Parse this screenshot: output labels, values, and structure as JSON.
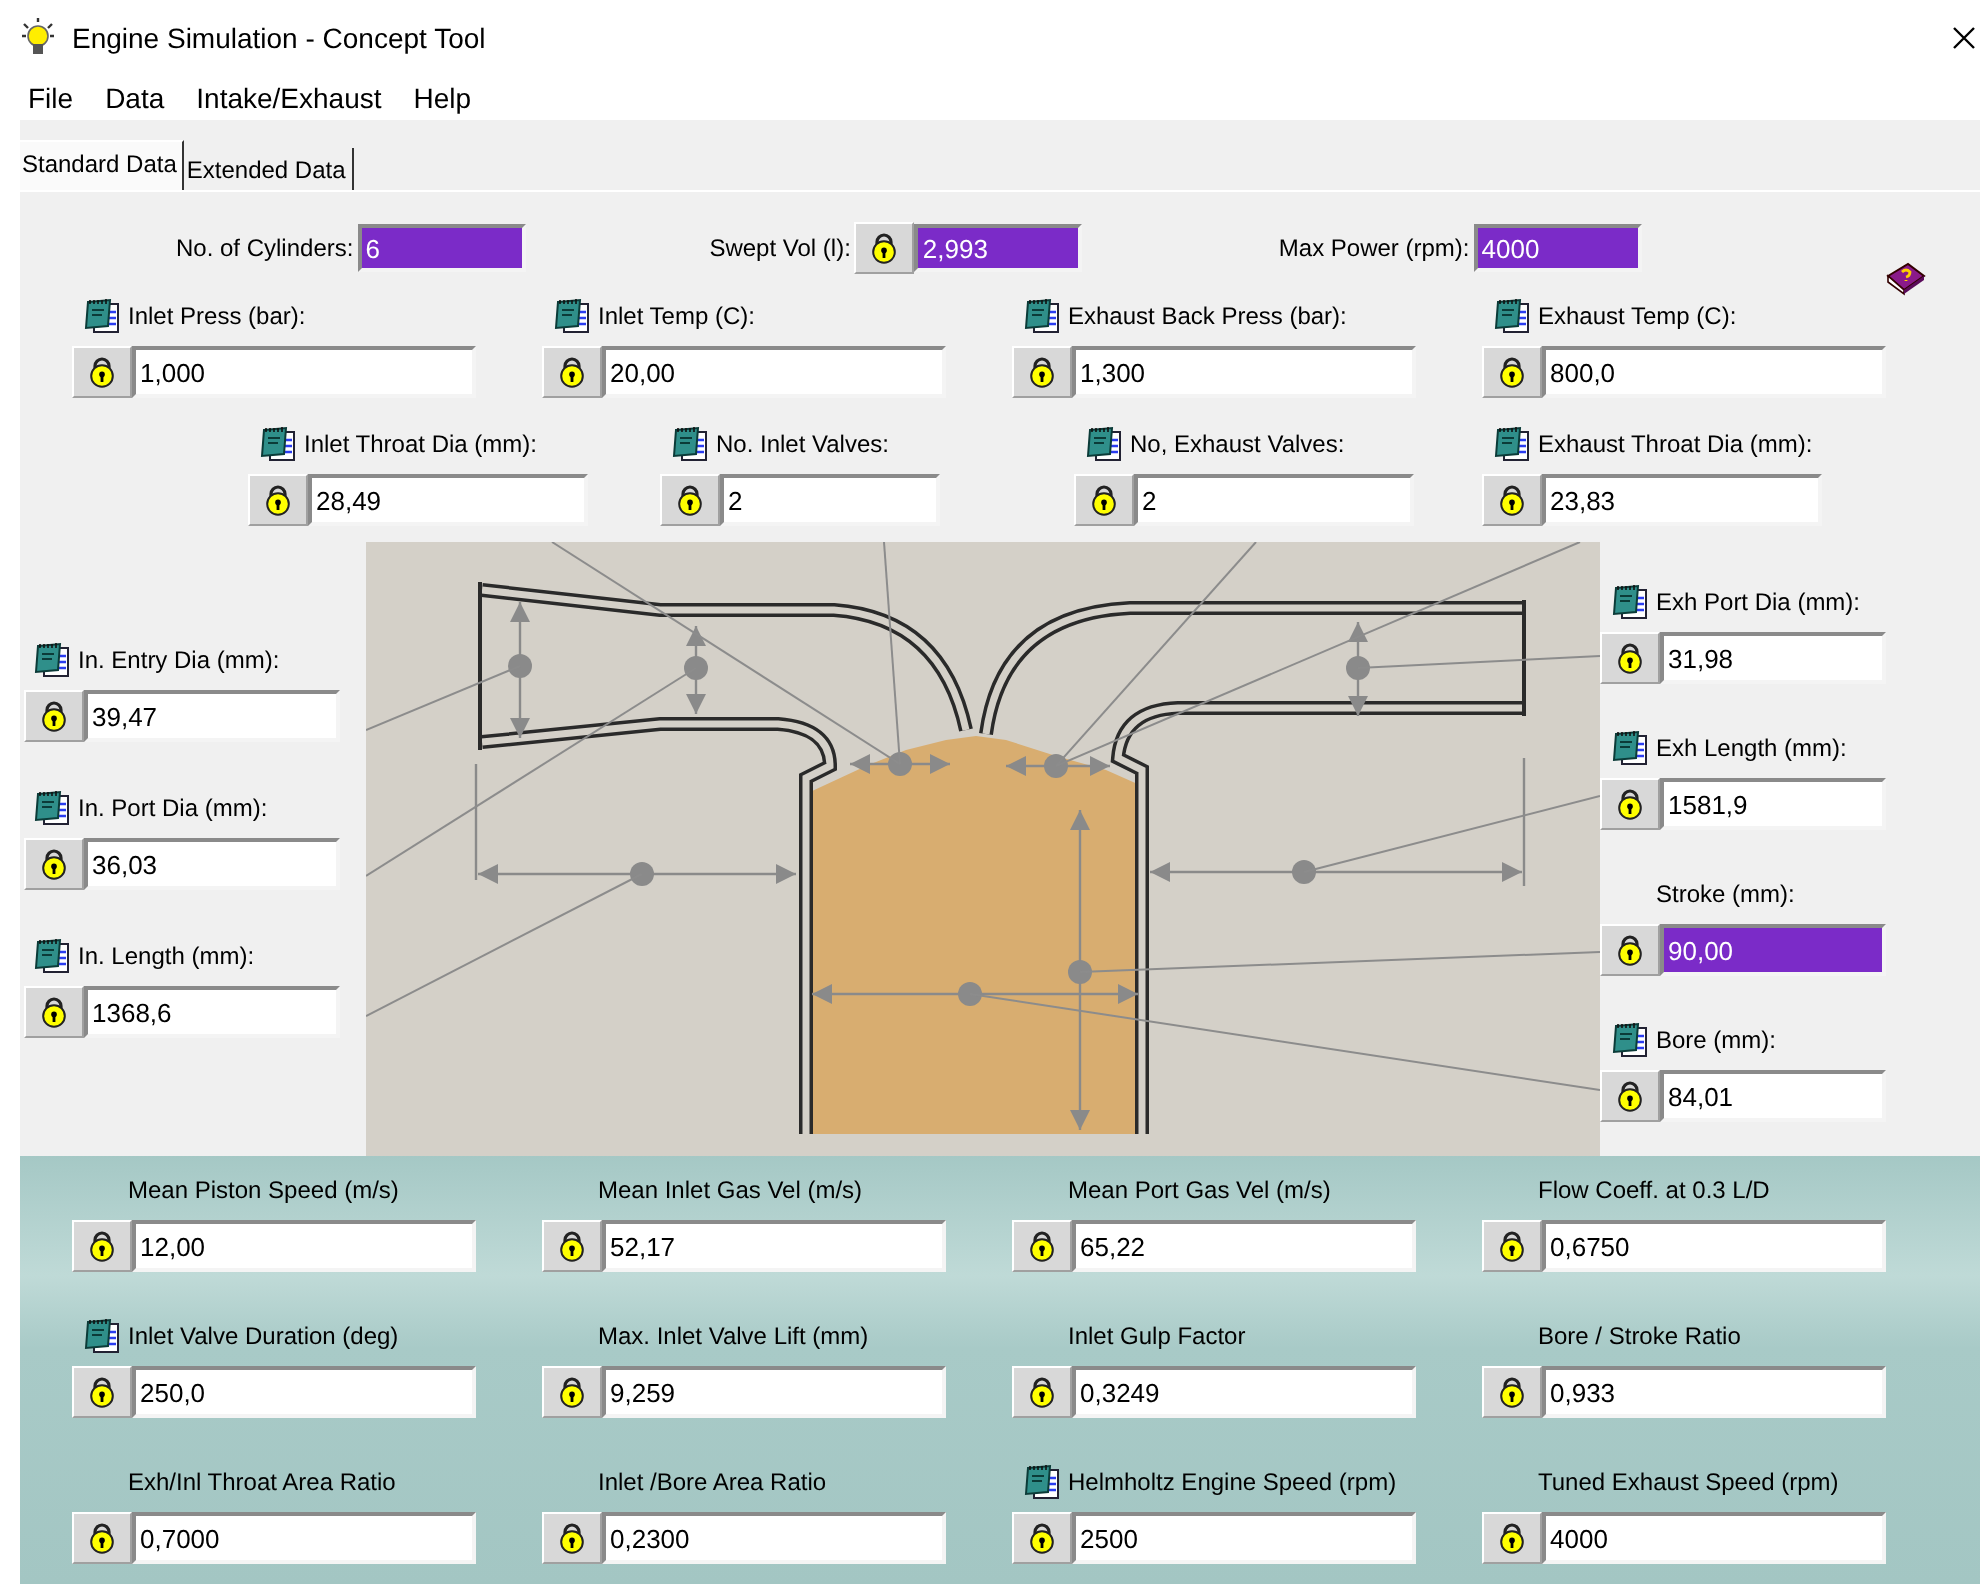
{
  "window": {
    "title": "Engine Simulation - Concept Tool"
  },
  "menu": [
    "File",
    "Data",
    "Intake/Exhaust",
    "Help"
  ],
  "tabs": [
    {
      "label": "Standard Data",
      "selected": true
    },
    {
      "label": "Extended Data",
      "selected": false
    }
  ],
  "summary": [
    {
      "label": "No. of Cylinders:",
      "value": "6",
      "lock": false,
      "highlighted": true
    },
    {
      "label": "Swept Vol (l):",
      "value": "2,993",
      "lock": true,
      "highlighted": true
    },
    {
      "label": "Max Power (rpm):",
      "value": "4000",
      "lock": false,
      "highlighted": true
    }
  ],
  "conditions": [
    {
      "label": "Inlet Press (bar):",
      "value": "1,000",
      "notes": true,
      "highlighted": false
    },
    {
      "label": "Inlet Temp (C):",
      "value": "20,00",
      "notes": true,
      "highlighted": false
    },
    {
      "label": "Exhaust Back Press (bar):",
      "value": "1,300",
      "notes": true,
      "highlighted": false
    },
    {
      "label": "Exhaust Temp (C):",
      "value": "800,0",
      "notes": true,
      "highlighted": false
    }
  ],
  "valves": [
    {
      "label": "Inlet Throat Dia (mm):",
      "value": "28,49",
      "notes": true,
      "highlighted": false
    },
    {
      "label": "No. Inlet Valves:",
      "value": "2",
      "notes": true,
      "highlighted": false
    },
    {
      "label": "No, Exhaust Valves:",
      "value": "2",
      "notes": true,
      "highlighted": false
    },
    {
      "label": "Exhaust Throat Dia (mm):",
      "value": "23,83",
      "notes": true,
      "highlighted": false
    }
  ],
  "intake": [
    {
      "label": "In. Entry Dia (mm):",
      "value": "39,47",
      "notes": true,
      "highlighted": false
    },
    {
      "label": "In. Port Dia (mm):",
      "value": "36,03",
      "notes": true,
      "highlighted": false
    },
    {
      "label": "In. Length (mm):",
      "value": "1368,6",
      "notes": true,
      "highlighted": false
    }
  ],
  "exhaust": [
    {
      "label": "Exh Port Dia (mm):",
      "value": "31,98",
      "notes": true,
      "highlighted": false
    },
    {
      "label": "Exh Length (mm):",
      "value": "1581,9",
      "notes": true,
      "highlighted": false
    },
    {
      "label": "Stroke (mm):",
      "value": "90,00",
      "notes": false,
      "highlighted": true
    },
    {
      "label": "Bore (mm):",
      "value": "84,01",
      "notes": true,
      "highlighted": false
    }
  ],
  "results": [
    {
      "label": "Mean Piston Speed (m/s)",
      "value": "12,00",
      "notes": false,
      "highlighted": false
    },
    {
      "label": "Mean Inlet Gas Vel (m/s)",
      "value": "52,17",
      "notes": false,
      "highlighted": false
    },
    {
      "label": "Mean Port Gas Vel (m/s)",
      "value": "65,22",
      "notes": false,
      "highlighted": false
    },
    {
      "label": "Flow Coeff. at 0.3 L/D",
      "value": "0,6750",
      "notes": false,
      "highlighted": false
    },
    {
      "label": "Inlet Valve Duration (deg)",
      "value": "250,0",
      "notes": true,
      "highlighted": false
    },
    {
      "label": "Max. Inlet Valve Lift (mm)",
      "value": "9,259",
      "notes": false,
      "highlighted": false
    },
    {
      "label": "Inlet Gulp Factor",
      "value": "0,3249",
      "notes": false,
      "highlighted": false
    },
    {
      "label": "Bore / Stroke Ratio",
      "value": "0,933",
      "notes": false,
      "highlighted": false
    },
    {
      "label": "Exh/Inl Throat Area Ratio",
      "value": "0,7000",
      "notes": false,
      "highlighted": false
    },
    {
      "label": "Inlet /Bore Area Ratio",
      "value": "0,2300",
      "notes": false,
      "highlighted": false
    },
    {
      "label": "Helmholtz Engine Speed (rpm)",
      "value": "2500",
      "notes": true,
      "highlighted": false
    },
    {
      "label": "Tuned Exhaust Speed (rpm)",
      "value": "4000",
      "notes": false,
      "highlighted": false
    }
  ]
}
